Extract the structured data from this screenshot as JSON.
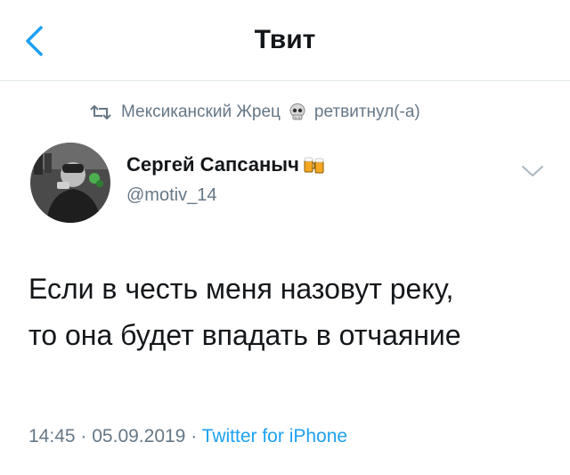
{
  "header": {
    "title": "Твит",
    "back_icon": "chevron-left-icon",
    "accent_color": "#1da1f2"
  },
  "retweet": {
    "icon": "retweet-icon",
    "user": "Мексиканский Жрец",
    "user_emoji": "skull-icon",
    "action": "ретвитнул(-а)"
  },
  "author": {
    "display_name": "Сергей Сапсаныч",
    "name_emoji": "beer-mugs-icon",
    "handle": "@motiv_14",
    "avatar": "avatar"
  },
  "tweet": {
    "lines": [
      "Если в честь меня назовут реку,",
      "то она будет впадать в отчаяние"
    ]
  },
  "meta": {
    "time": "14:45",
    "separator": "·",
    "date": "05.09.2019",
    "source": "Twitter for iPhone"
  }
}
